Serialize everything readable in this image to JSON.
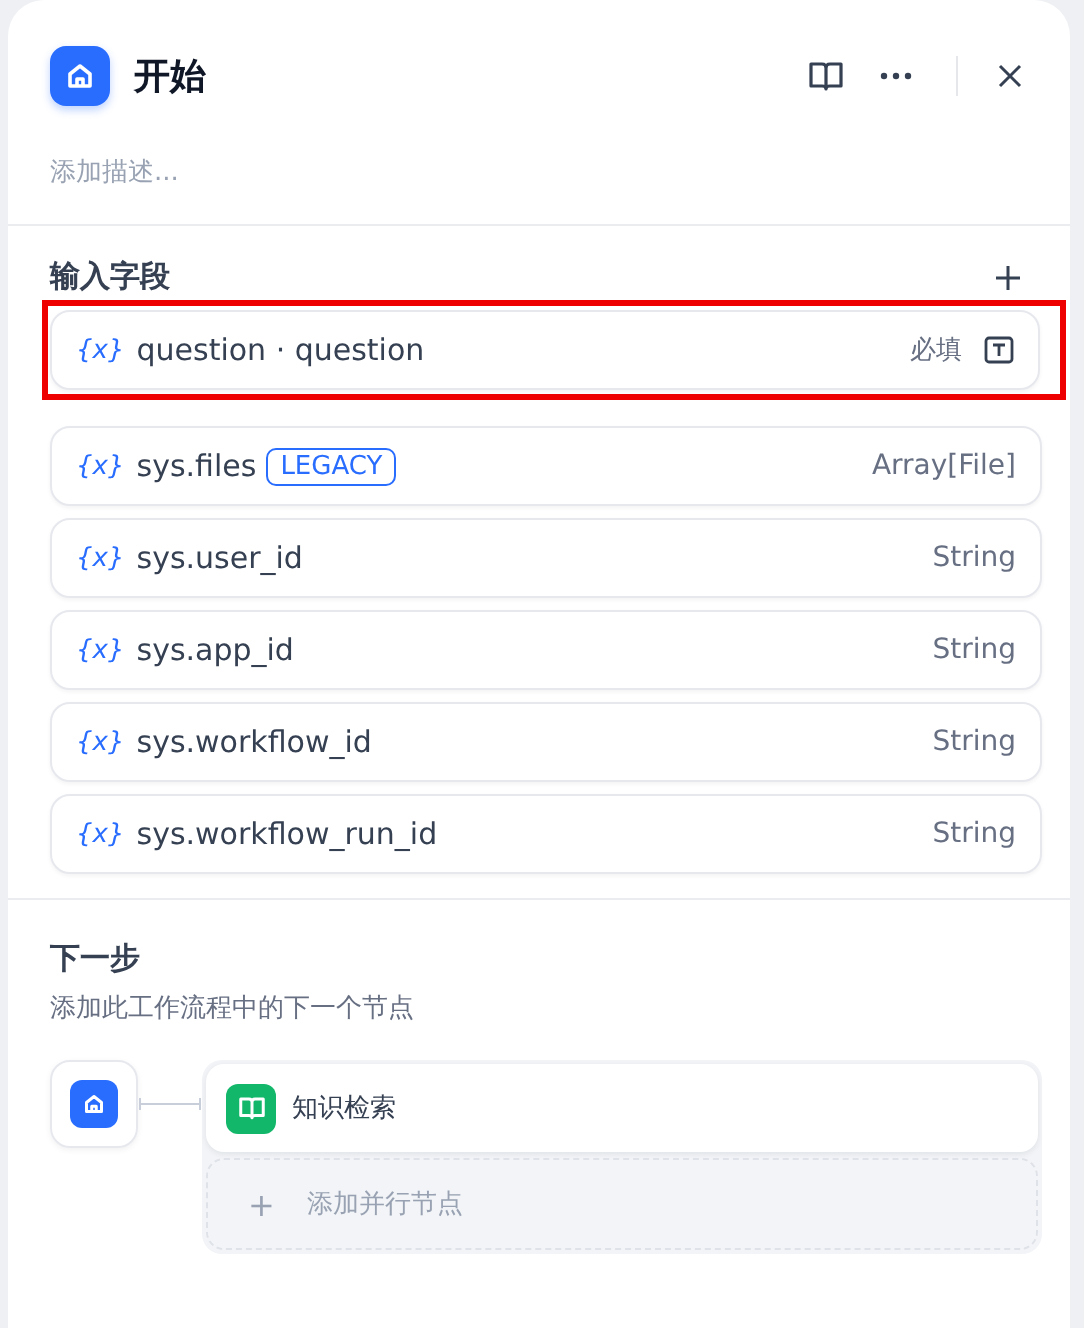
{
  "panel": {
    "title": "开始",
    "description_placeholder": "添加描述..."
  },
  "input_fields": {
    "title": "输入字段",
    "fields": [
      {
        "kind": "input",
        "icon": "{x}",
        "name": "question · question",
        "required_label": "必填",
        "highlighted": true
      },
      {
        "kind": "system",
        "icon": "{x}",
        "name": "sys.files",
        "tag": "LEGACY",
        "type": "Array[File]",
        "highlighted": false
      },
      {
        "kind": "system",
        "icon": "{x}",
        "name": "sys.user_id",
        "type": "String",
        "highlighted": false
      },
      {
        "kind": "system",
        "icon": "{x}",
        "name": "sys.app_id",
        "type": "String",
        "highlighted": false
      },
      {
        "kind": "system",
        "icon": "{x}",
        "name": "sys.workflow_id",
        "type": "String",
        "highlighted": false
      },
      {
        "kind": "system",
        "icon": "{x}",
        "name": "sys.workflow_run_id",
        "type": "String",
        "highlighted": false
      }
    ]
  },
  "next_step": {
    "title": "下一步",
    "subtitle": "添加此工作流程中的下一个节点",
    "nodes": [
      {
        "label": "知识检索"
      }
    ],
    "add_parallel": {
      "icon": "+",
      "label": "添加并行节点"
    }
  }
}
